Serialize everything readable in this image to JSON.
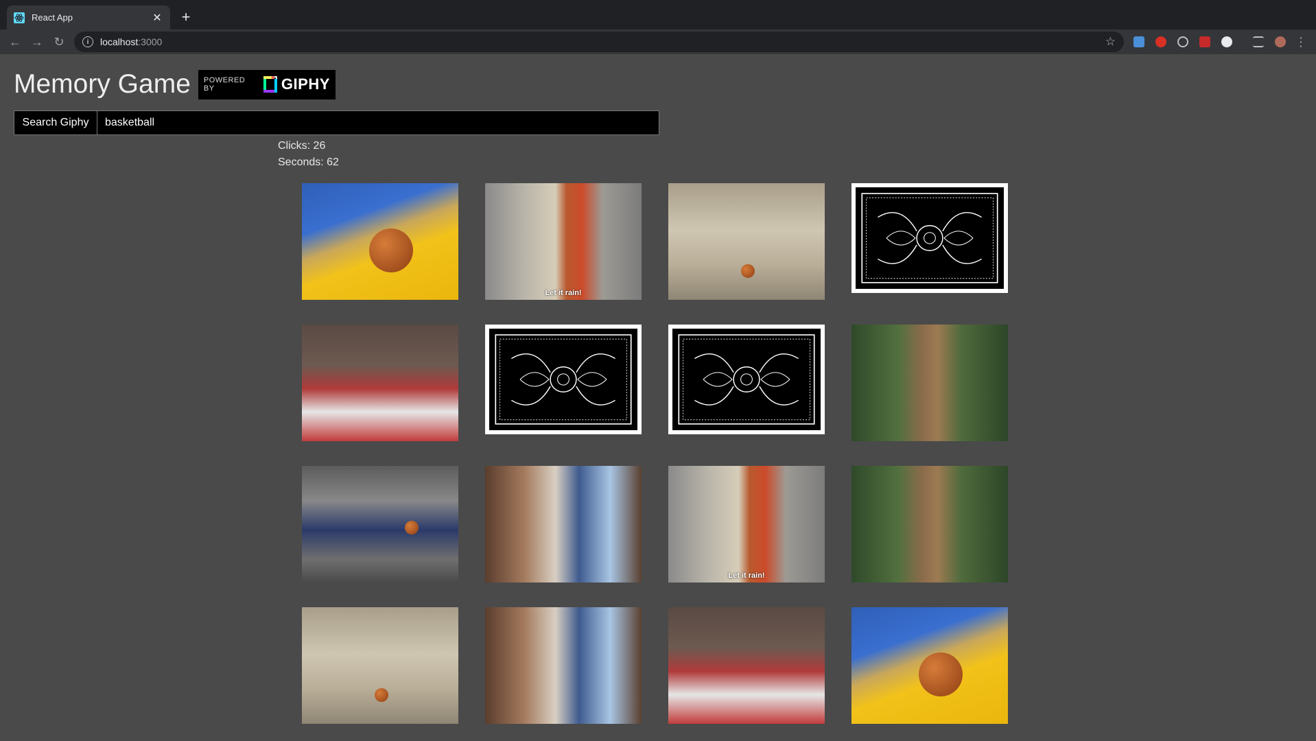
{
  "browser": {
    "tab_title": "React App",
    "url_host": "localhost",
    "url_port": ":3000"
  },
  "app": {
    "title": "Memory Game",
    "giphy_badge": {
      "powered_by": "POWERED BY",
      "brand": "GIPHY"
    }
  },
  "search": {
    "button_label": "Search Giphy",
    "value": "basketball"
  },
  "stats": {
    "clicks_label": "Clicks: 26",
    "seconds_label": "Seconds: 62"
  },
  "cards": [
    {
      "state": "face-up",
      "gif": "curry"
    },
    {
      "state": "face-up",
      "gif": "let-it-rain",
      "caption": "Let it rain!"
    },
    {
      "state": "face-up",
      "gif": "alley-dribble"
    },
    {
      "state": "face-down"
    },
    {
      "state": "face-up",
      "gif": "butler"
    },
    {
      "state": "face-down"
    },
    {
      "state": "face-down"
    },
    {
      "state": "face-up",
      "gif": "jungle-hoop"
    },
    {
      "state": "face-up",
      "gif": "dunk"
    },
    {
      "state": "face-up",
      "gif": "bench"
    },
    {
      "state": "face-up",
      "gif": "let-it-rain",
      "caption": "Let it rain!"
    },
    {
      "state": "face-up",
      "gif": "jungle-hoop"
    },
    {
      "state": "face-up",
      "gif": "alley-dribble"
    },
    {
      "state": "face-up",
      "gif": "bench"
    },
    {
      "state": "face-up",
      "gif": "butler"
    },
    {
      "state": "face-up",
      "gif": "curry"
    }
  ],
  "icons": {
    "back": "arrow-left-icon",
    "forward": "arrow-right-icon",
    "reload": "reload-icon",
    "info": "info-icon",
    "bookmark": "star-icon",
    "menu": "kebab-menu-icon"
  }
}
